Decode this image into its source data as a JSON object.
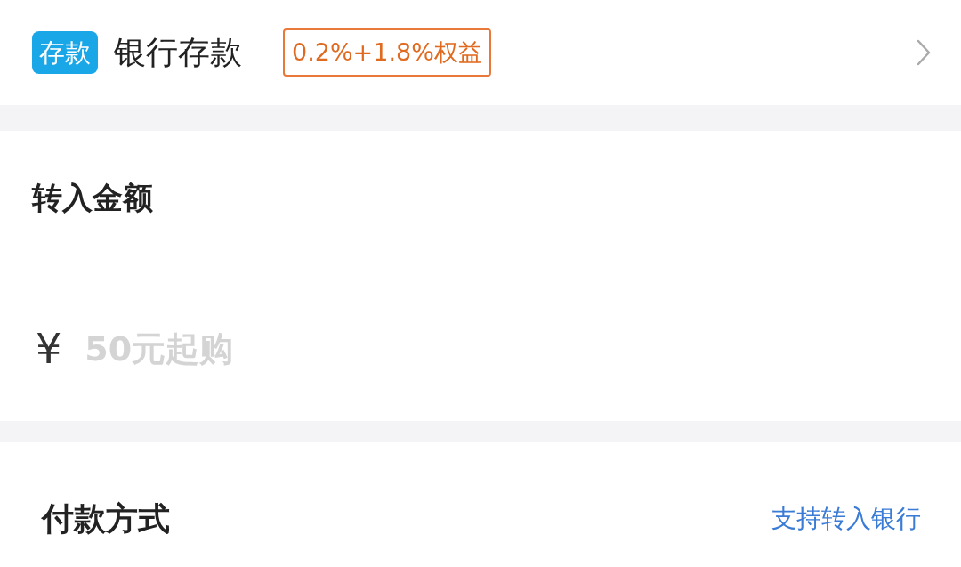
{
  "product": {
    "badge": "存款",
    "title": "银行存款",
    "tag": "0.2%+1.8%权益"
  },
  "amount": {
    "label": "转入金额",
    "currency": "¥",
    "placeholder": "50元起购"
  },
  "payment": {
    "label": "付款方式",
    "link": "支持转入银行"
  }
}
